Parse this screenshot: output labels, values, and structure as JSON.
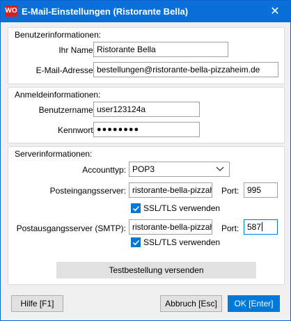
{
  "window": {
    "logo_text": "WO",
    "title": "E-Mail-Einstellungen (Ristorante Bella)",
    "close_glyph": "✕"
  },
  "user_info": {
    "section_title": "Benutzerinformationen:",
    "name_label": "Ihr Name:",
    "name_value": "Ristorante Bella",
    "email_label": "E-Mail-Adresse:",
    "email_value": "bestellungen@ristorante-bella-pizzaheim.de"
  },
  "login_info": {
    "section_title": "Anmeldeinformationen:",
    "username_label": "Benutzername:",
    "username_value": "user123124a",
    "password_label": "Kennwort:",
    "password_value": "●●●●●●●●"
  },
  "server_info": {
    "section_title": "Serverinformationen:",
    "account_type_label": "Accounttyp:",
    "account_type_value": "POP3",
    "incoming_label": "Posteingangsserver:",
    "incoming_value": "ristorante-bella-pizzah",
    "incoming_port_label": "Port:",
    "incoming_port_value": "995",
    "incoming_ssl_label": "SSL/TLS verwenden",
    "incoming_ssl_checked": true,
    "outgoing_label": "Postausgangsserver (SMTP):",
    "outgoing_value": "ristorante-bella-pizzah",
    "outgoing_port_label": "Port:",
    "outgoing_port_value": "587",
    "outgoing_ssl_label": "SSL/TLS verwenden",
    "outgoing_ssl_checked": true,
    "test_button_label": "Testbestellung versenden"
  },
  "footer": {
    "help_label": "Hilfe [F1]",
    "cancel_label": "Abbruch [Esc]",
    "ok_label": "OK [Enter]"
  },
  "colors": {
    "titlebar": "#0a6fd8",
    "accent": "#0078d7",
    "logo": "#d82020"
  }
}
